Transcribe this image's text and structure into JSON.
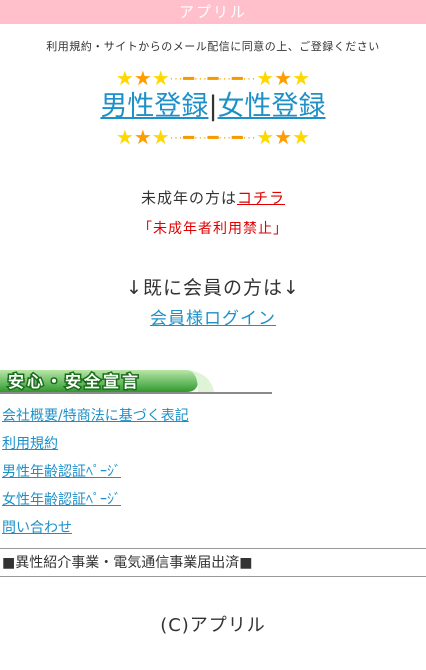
{
  "header": {
    "title": "アプリル"
  },
  "consent_text": "利用規約・サイトからのメール配信に同意の上、ご登録ください",
  "colors": {
    "header_bg": "#ffc0cb",
    "link": "#1e90c8",
    "warning": "#e10000",
    "banner_green": "#3fa33f"
  },
  "register": {
    "male_label": "男性登録",
    "separator": "|",
    "female_label": "女性登録"
  },
  "minors": {
    "prefix": "未成年の方は",
    "link_label": "コチラ",
    "warning": "「未成年者利用禁止」"
  },
  "member": {
    "prompt": "↓既に会員の方は↓",
    "login_label": "会員様ログイン"
  },
  "safety_banner": {
    "text": "安心・安全宣言"
  },
  "links": [
    {
      "label": "会社概要/特商法に基づく表記",
      "name": "company-info-link"
    },
    {
      "label": "利用規約",
      "name": "terms-link"
    },
    {
      "label": "男性年齢認証ﾍﾟｰｼﾞ",
      "name": "male-age-verification-link"
    },
    {
      "label": "女性年齢認証ﾍﾟｰｼﾞ",
      "name": "female-age-verification-link"
    },
    {
      "label": "問い合わせ",
      "name": "contact-link"
    }
  ],
  "notice": "■異性紹介事業・電気通信事業届出済■",
  "copyright": "(C)アプリル"
}
